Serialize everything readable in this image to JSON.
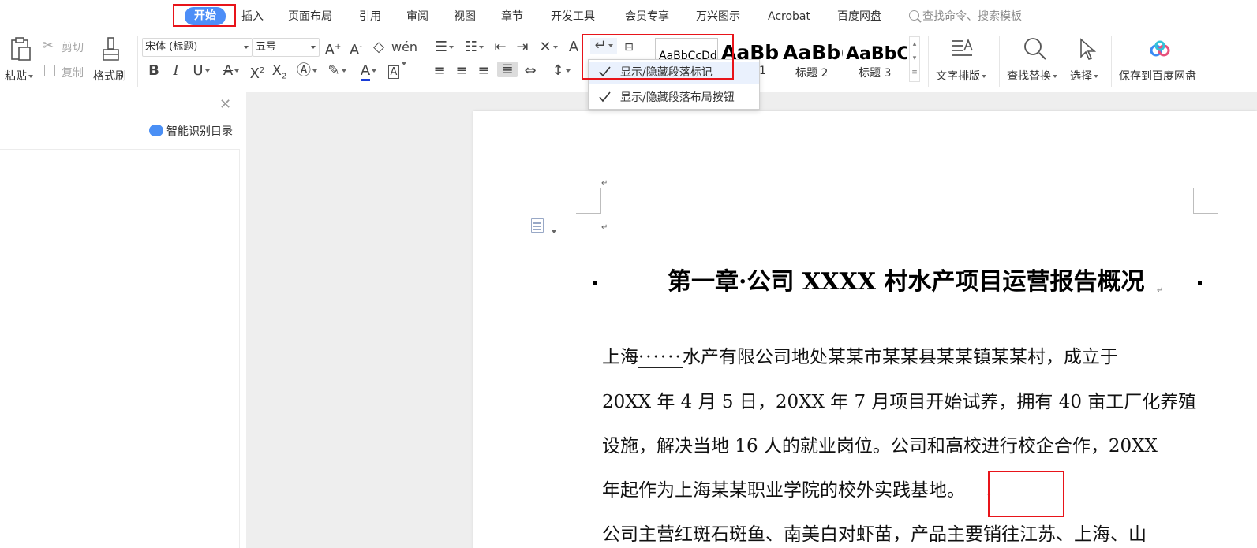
{
  "menu": {
    "tabs": [
      "开始",
      "插入",
      "页面布局",
      "引用",
      "审阅",
      "视图",
      "章节",
      "开发工具",
      "会员专享",
      "万兴图示",
      "Acrobat",
      "百度网盘"
    ],
    "active_tab": "开始",
    "search_placeholder": "查找命令、搜索模板"
  },
  "ribbon": {
    "paste": "粘贴",
    "cut": "剪切",
    "copy": "复制",
    "format_painter": "格式刷",
    "font_name": "宋体 (标题)",
    "font_size": "五号",
    "styles": [
      {
        "preview": "AaBbCcDd",
        "label": ""
      },
      {
        "preview": "AaBbC",
        "label": "1"
      },
      {
        "preview": "AaBb(",
        "label": "标题 2"
      },
      {
        "preview": "AaBbC",
        "label": "标题 3"
      }
    ],
    "text_layout": "文字排版",
    "find_replace": "查找替换",
    "select": "选择",
    "save_baidu": "保存到百度网盘"
  },
  "dropdown": {
    "items": [
      "显示/隐藏段落标记",
      "显示/隐藏段落布局按钮"
    ]
  },
  "nav_pane": {
    "smart_toc": "智能识别目录"
  },
  "document": {
    "title": "第一章·公司 XXXX 村水产项目运营报告概况",
    "para1_prefix": "上海",
    "para1_dots": "······",
    "para1_rest": "水产有限公司地处某某市某某县某某镇某某村，成立于",
    "lines": [
      "20XX 年 4 月 5 日，20XX 年 7 月项目开始试养，拥有 40 亩工厂化养殖",
      "设施，解决当地 16 人的就业岗位。公司和高校进行校企合作，20XX",
      "年起作为上海某某职业学院的校外实践基地。"
    ],
    "partial_line": "公司主营红斑石斑鱼、南美白对虾苗，产品主要销往江苏、上海、山"
  },
  "colors": {
    "accent": "#4d8ef7",
    "highlight": "#e8141a"
  }
}
